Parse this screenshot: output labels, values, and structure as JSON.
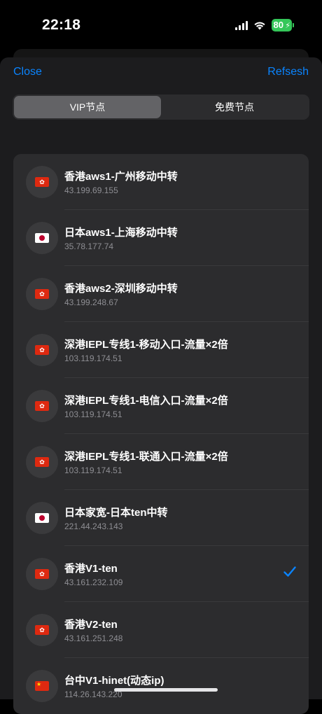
{
  "status": {
    "time": "22:18",
    "battery": "80"
  },
  "nav": {
    "close_label": "Close",
    "refresh_label": "Refsesh"
  },
  "tabs": [
    {
      "label": "VIP节点",
      "active": true
    },
    {
      "label": "免费节点",
      "active": false
    }
  ],
  "nodes": [
    {
      "name": "香港aws1-广州移动中转",
      "ip": "43.199.69.155",
      "flag": "hk",
      "selected": false
    },
    {
      "name": "日本aws1-上海移动中转",
      "ip": "35.78.177.74",
      "flag": "jp",
      "selected": false
    },
    {
      "name": "香港aws2-深圳移动中转",
      "ip": "43.199.248.67",
      "flag": "hk",
      "selected": false
    },
    {
      "name": "深港IEPL专线1-移动入口-流量×2倍",
      "ip": "103.119.174.51",
      "flag": "hk",
      "selected": false
    },
    {
      "name": "深港IEPL专线1-电信入口-流量×2倍",
      "ip": "103.119.174.51",
      "flag": "hk",
      "selected": false
    },
    {
      "name": "深港IEPL专线1-联通入口-流量×2倍",
      "ip": "103.119.174.51",
      "flag": "hk",
      "selected": false
    },
    {
      "name": "日本家宽-日本ten中转",
      "ip": "221.44.243.143",
      "flag": "jp",
      "selected": false
    },
    {
      "name": "香港V1-ten",
      "ip": "43.161.232.109",
      "flag": "hk",
      "selected": true
    },
    {
      "name": "香港V2-ten",
      "ip": "43.161.251.248",
      "flag": "hk",
      "selected": false
    },
    {
      "name": "台中V1-hinet(动态ip)",
      "ip": "114.26.143.220",
      "flag": "cn",
      "selected": false
    }
  ],
  "colors": {
    "accent": "#0a84ff",
    "battery": "#34c759"
  }
}
